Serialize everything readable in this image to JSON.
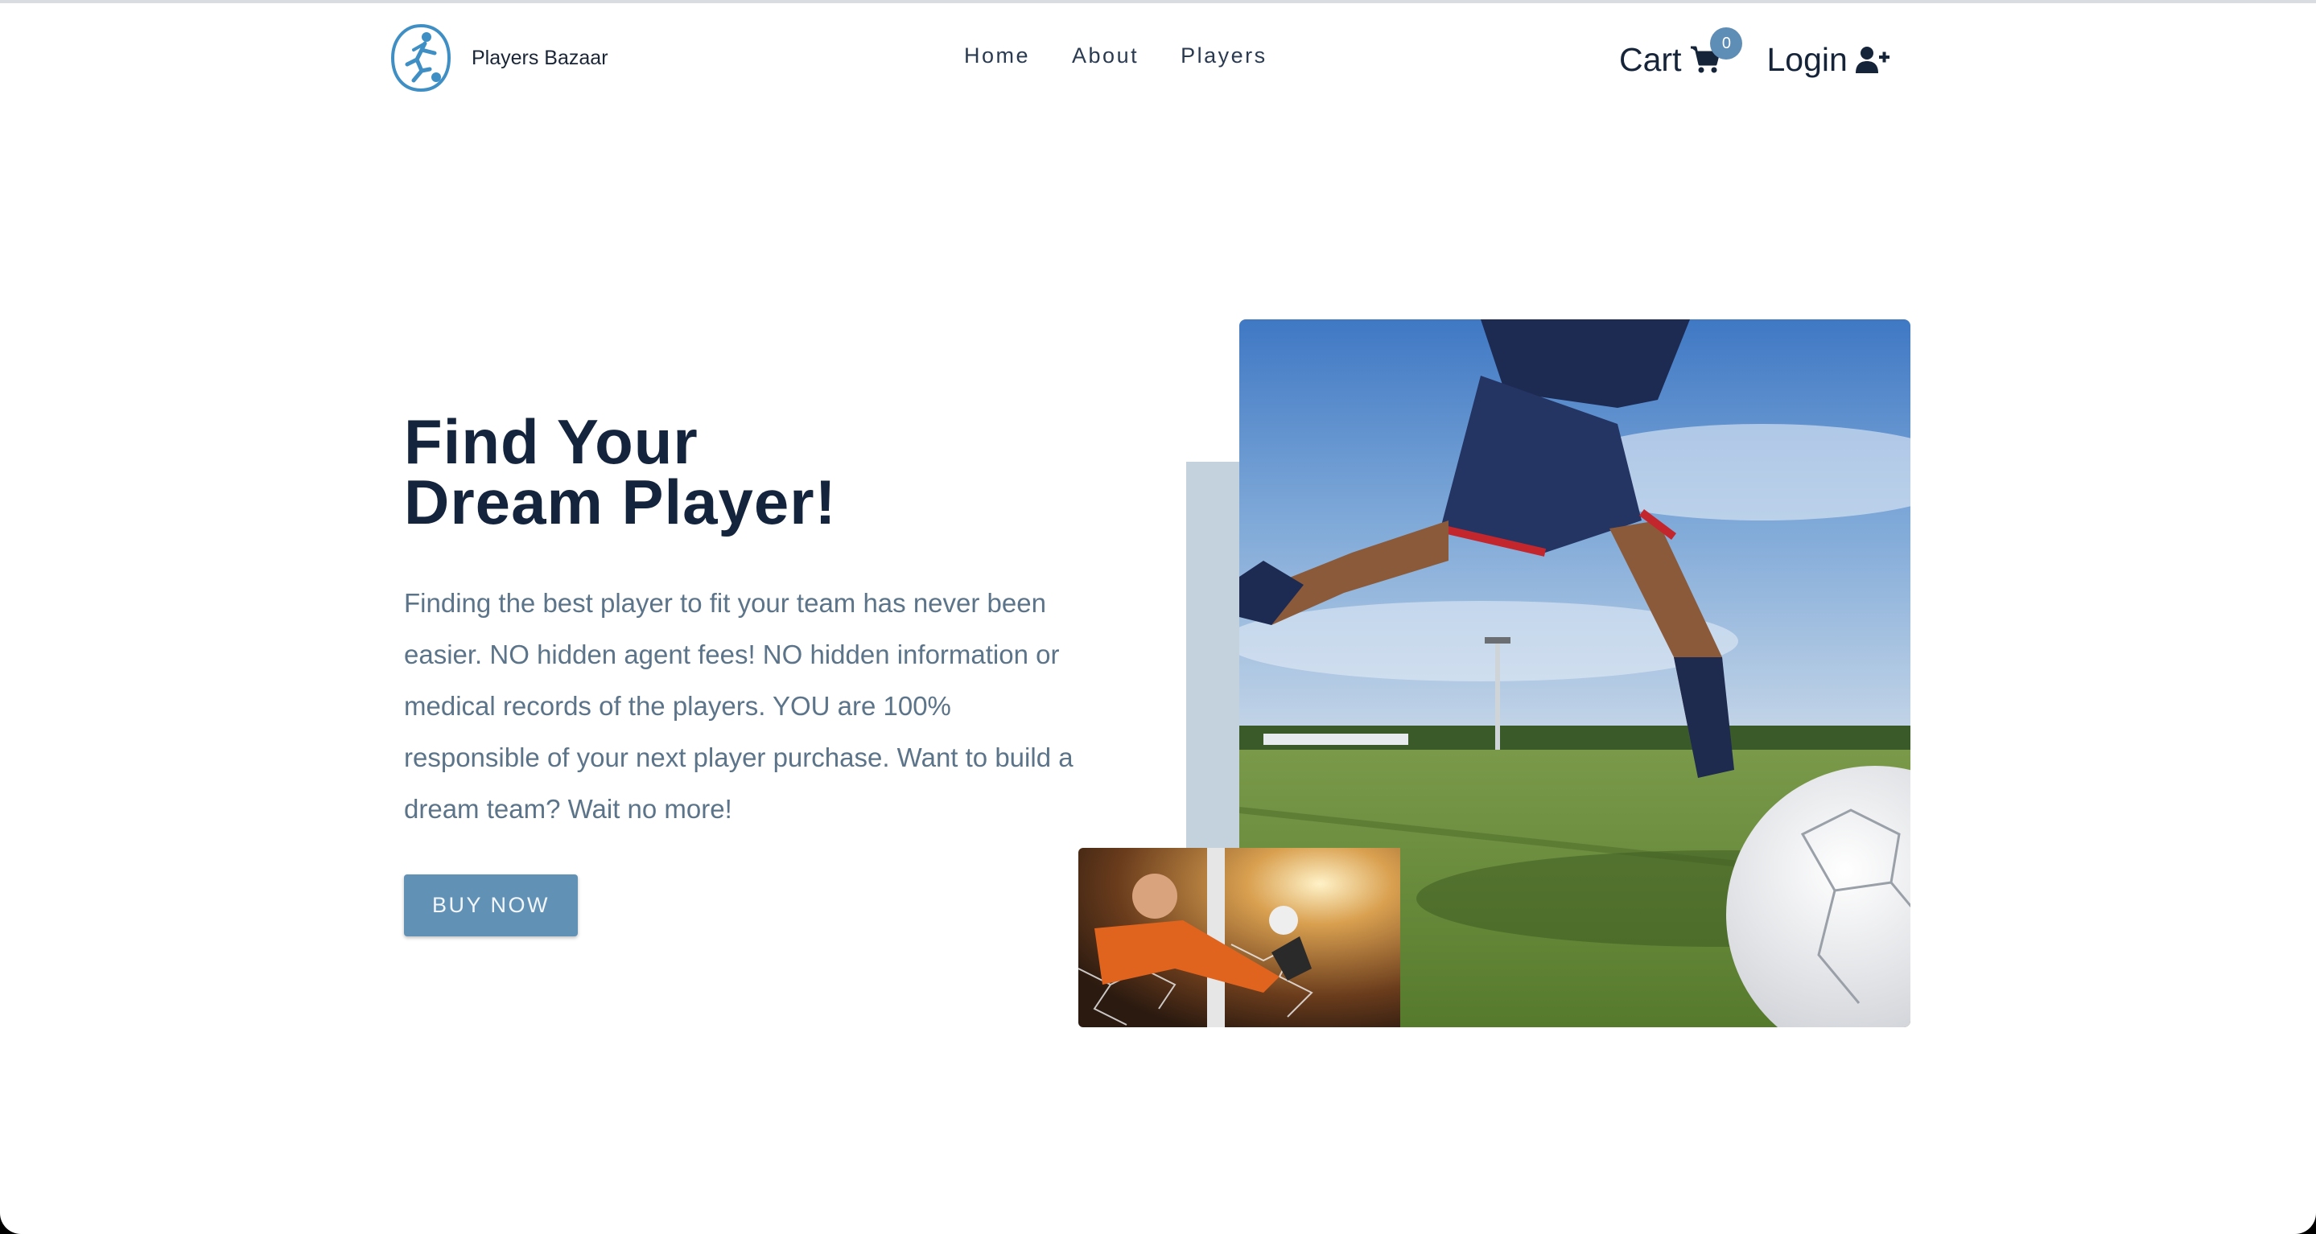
{
  "brand": {
    "name": "Players Bazaar",
    "logo_icon": "soccer-player-logo-icon"
  },
  "nav": {
    "links": [
      {
        "label": "Home"
      },
      {
        "label": "About"
      },
      {
        "label": "Players"
      }
    ],
    "cart": {
      "label": "Cart",
      "icon": "cart-icon",
      "count": "0"
    },
    "login": {
      "label": "Login",
      "icon": "user-plus-icon"
    }
  },
  "hero": {
    "title_line1": "Find Your",
    "title_line2": "Dream Player!",
    "description": "Finding the best player to fit your team has never been easier. NO hidden agent fees! NO hidden information or medical records of the players. YOU are 100% responsible of your next player purchase. Want to build a dream team? Wait no more!",
    "button_label": "BUY NOW"
  },
  "colors": {
    "heading": "#14243d",
    "body_text": "#5c7489",
    "accent": "#6291b6",
    "accent_bar": "#c4d2de",
    "badge": "#5e8db5"
  }
}
